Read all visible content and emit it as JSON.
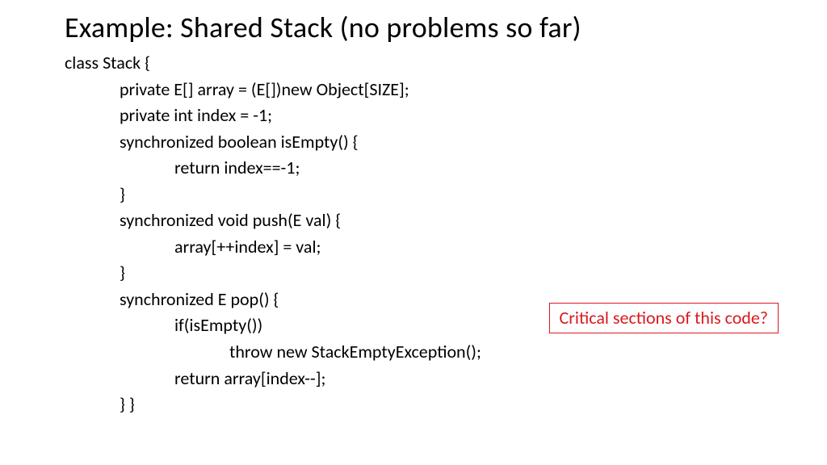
{
  "title": "Example: Shared Stack (no problems so far)",
  "code": {
    "l1": "class Stack {",
    "l2": "private E[] array = (E[])new Object[SIZE];",
    "l3": "private int index = -1;",
    "l4": "synchronized boolean isEmpty() {",
    "l5": "return index==-1;",
    "l6": "}",
    "l7": "synchronized void push(E val) {",
    "l8": "array[++index] = val;",
    "l9": "}",
    "l10": "synchronized E pop() {",
    "l11": "if(isEmpty())",
    "l12": "throw new StackEmptyException();",
    "l13": "return array[index--];",
    "l14": "} }"
  },
  "callout": "Critical sections of this code?"
}
